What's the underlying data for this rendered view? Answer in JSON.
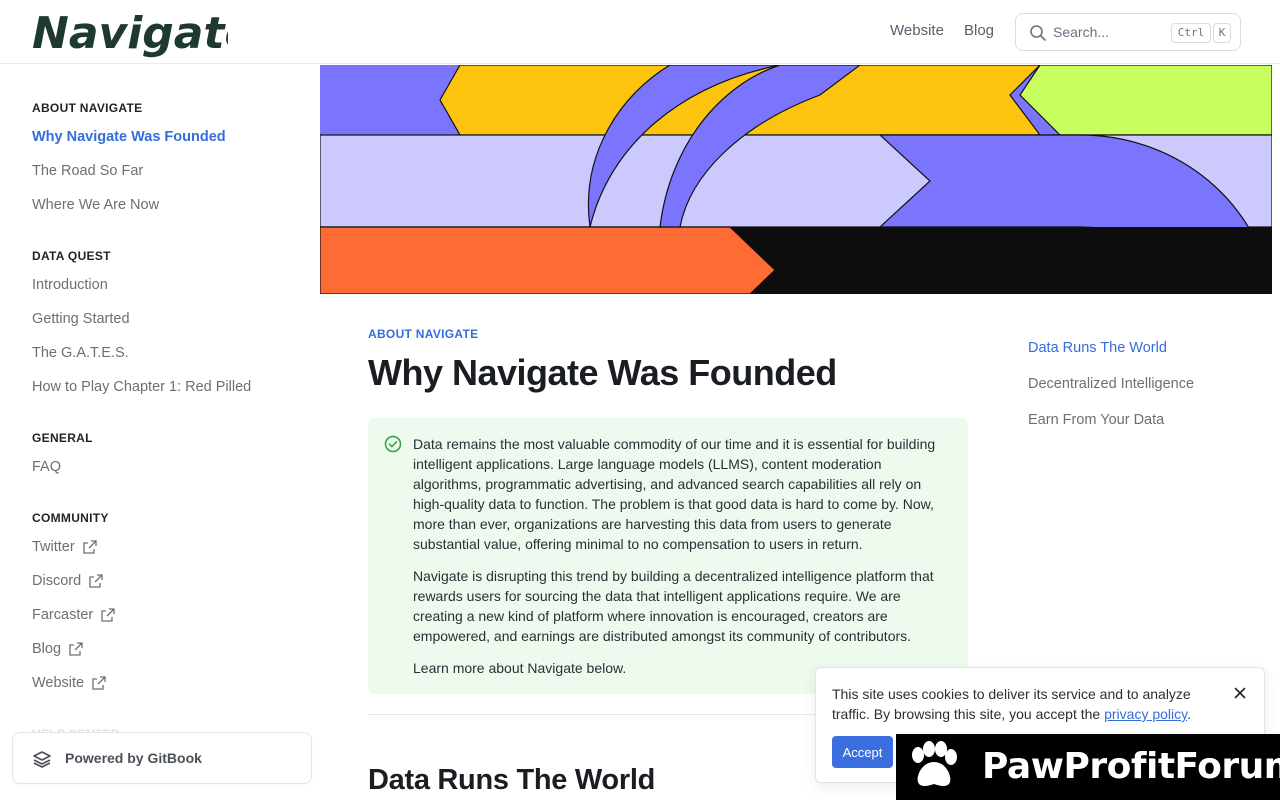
{
  "header": {
    "logo_text": "Navigate",
    "nav": [
      "Website",
      "Blog"
    ],
    "search": {
      "placeholder": "Search...",
      "shortcut_ctrl": "Ctrl",
      "shortcut_key": "K"
    }
  },
  "sidebar": {
    "sections": [
      {
        "title": "ABOUT NAVIGATE",
        "items": [
          "Why Navigate Was Founded",
          "The Road So Far",
          "Where We Are Now"
        ]
      },
      {
        "title": "DATA QUEST",
        "items": [
          "Introduction",
          "Getting Started",
          "The G.A.T.E.S.",
          "How to Play Chapter 1: Red Pilled"
        ]
      },
      {
        "title": "GENERAL",
        "items": [
          "FAQ"
        ]
      },
      {
        "title": "COMMUNITY",
        "items": [
          "Twitter",
          "Discord",
          "Farcaster",
          "Blog",
          "Website"
        ]
      }
    ],
    "active_item": "Why Navigate Was Founded",
    "faded_section": "HELP CENTER",
    "powered_by": "Powered by GitBook"
  },
  "main": {
    "eyebrow": "ABOUT NAVIGATE",
    "title": "Why Navigate Was Founded",
    "hint_paragraphs": [
      "Data remains the most valuable commodity of our time and it is essential for building intelligent applications. Large language models (LLMS), content moderation algorithms, programmatic advertising, and advanced search capabilities all rely on high-quality data to function. The problem is that good data is hard to come by. Now, more than ever, organizations are harvesting this data from users to generate substantial value, offering minimal to no compensation to users in return.",
      "Navigate is disrupting this trend by building a decentralized intelligence platform that rewards users for sourcing the data that intelligent applications require. We are creating a new kind of platform where innovation is encouraged, creators are empowered, and earnings are distributed amongst its community of contributors.",
      "Learn more about Navigate below."
    ],
    "section_heading": "Data Runs The World"
  },
  "toc": [
    "Data Runs The World",
    "Decentralized Intelligence",
    "Earn From Your Data"
  ],
  "cookie": {
    "text_before": "This site uses cookies to deliver its service and to analyze traffic. By browsing this site, you accept the ",
    "link_text": "privacy policy",
    "text_after": ".",
    "accept_label": "Accept"
  },
  "watermark": {
    "text": "PawProfitForum"
  },
  "colors": {
    "accent": "#346ddb",
    "hint_bg": "#eefaee",
    "hint_icon": "#2ea043",
    "hero_purple": "#7b75fd",
    "hero_yellow": "#fdc40f",
    "hero_lime": "#c8ff5e",
    "hero_lavender": "#ccc9fd",
    "hero_orange": "#ff6b35",
    "hero_black": "#0d0d0d"
  }
}
